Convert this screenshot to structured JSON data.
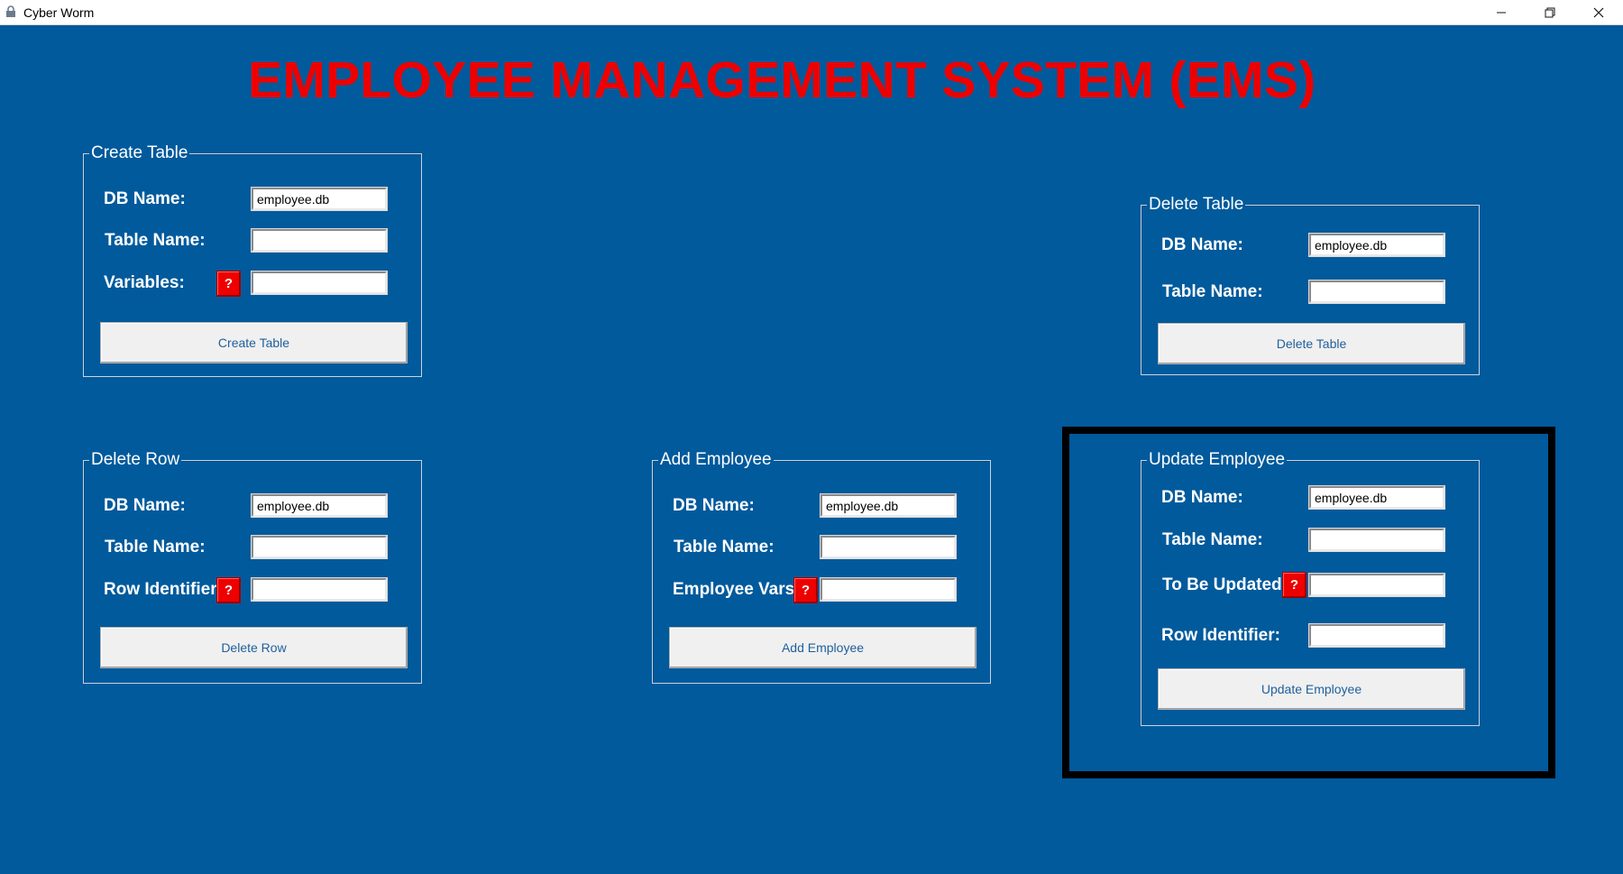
{
  "window": {
    "title": "Cyber Worm",
    "controls": [
      "minimize-icon",
      "restore-icon",
      "close-icon"
    ]
  },
  "colors": {
    "background": "#005a9c",
    "title_text": "#ee0000",
    "help_button": "#ee0000",
    "button_text": "#1f5f9b",
    "highlight_border": "#000000"
  },
  "heading": "EMPLOYEE MANAGEMENT SYSTEM (EMS)",
  "help_label": "?",
  "create_table": {
    "title": "Create Table",
    "db_label": "DB Name:",
    "db_value": "employee.db",
    "table_label": "Table Name:",
    "table_value": "",
    "vars_label": "Variables:",
    "vars_value": "",
    "button": "Create Table"
  },
  "delete_table": {
    "title": "Delete Table",
    "db_label": "DB Name:",
    "db_value": "employee.db",
    "table_label": "Table Name:",
    "table_value": "",
    "button": "Delete Table"
  },
  "delete_row": {
    "title": "Delete Row",
    "db_label": "DB Name:",
    "db_value": "employee.db",
    "table_label": "Table Name:",
    "table_value": "",
    "row_label": "Row Identifier:",
    "row_value": "",
    "button": "Delete Row"
  },
  "add_employee": {
    "title": "Add Employee",
    "db_label": "DB Name:",
    "db_value": "employee.db",
    "table_label": "Table Name:",
    "table_value": "",
    "vars_label": "Employee Vars:",
    "vars_value": "",
    "button": "Add Employee"
  },
  "update_employee": {
    "title": "Update Employee",
    "db_label": "DB Name:",
    "db_value": "employee.db",
    "table_label": "Table Name:",
    "table_value": "",
    "update_label": "To Be Updated:",
    "update_value": "",
    "row_label": "Row Identifier:",
    "row_value": "",
    "button": "Update Employee"
  }
}
